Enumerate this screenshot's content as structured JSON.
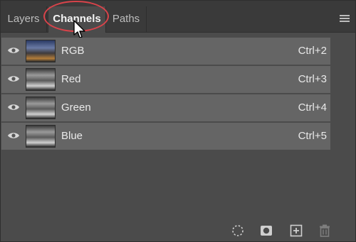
{
  "tabs": {
    "layers": "Layers",
    "channels": "Channels",
    "paths": "Paths"
  },
  "channels": [
    {
      "name": "RGB",
      "shortcut": "Ctrl+2",
      "visible": true,
      "thumb": "rgb"
    },
    {
      "name": "Red",
      "shortcut": "Ctrl+3",
      "visible": true,
      "thumb": "gray"
    },
    {
      "name": "Green",
      "shortcut": "Ctrl+4",
      "visible": true,
      "thumb": "gray"
    },
    {
      "name": "Blue",
      "shortcut": "Ctrl+5",
      "visible": true,
      "thumb": "gray"
    }
  ],
  "icons": {
    "menu": "panel-menu-icon",
    "eye": "eye-icon",
    "selection": "load-channel-as-selection-icon",
    "mask": "save-selection-as-channel-icon",
    "new": "new-channel-icon",
    "trash": "delete-channel-icon"
  },
  "colors": {
    "highlight": "#d9434a",
    "row": "#656565",
    "panel": "#4b4b4b"
  }
}
